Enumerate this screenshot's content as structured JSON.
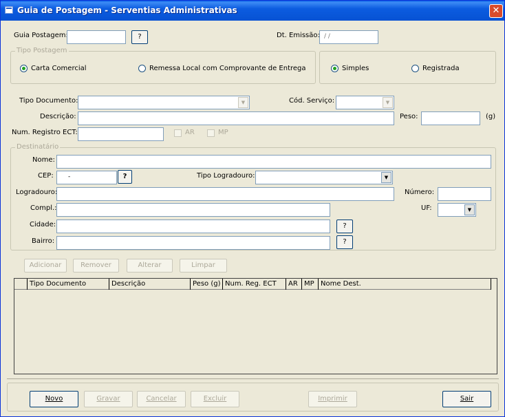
{
  "window": {
    "title": "Guia de Postagem - Serventias Administrativas",
    "close_glyph": "✕"
  },
  "header": {
    "guia_label": "Guia Postagem:",
    "guia_value": "",
    "guia_help": "?",
    "dt_label": "Dt. Emissão:",
    "dt_value": "/ /"
  },
  "tipo_postagem": {
    "caption": "Tipo Postagem",
    "options": [
      {
        "label": "Carta Comercial",
        "selected": true
      },
      {
        "label": "Remessa Local com Comprovante de Entrega",
        "selected": false
      }
    ]
  },
  "registro_tipo": {
    "options": [
      {
        "label": "Simples",
        "selected": true
      },
      {
        "label": "Registrada",
        "selected": false
      }
    ]
  },
  "documento": {
    "tipo_label": "Tipo Documento:",
    "tipo_value": "",
    "cod_label": "Cód. Serviço:",
    "cod_value": "",
    "descricao_label": "Descrição:",
    "descricao_value": "",
    "peso_label": "Peso:",
    "peso_value": "",
    "peso_unit": "(g)",
    "registro_label": "Num. Registro ECT:",
    "registro_value": "",
    "ar_label": "AR",
    "mp_label": "MP"
  },
  "destinatario": {
    "caption": "Destinatário",
    "nome_label": "Nome:",
    "cep_label": "CEP:",
    "cep_value": "-",
    "cep_help": "?",
    "tipo_logradouro_label": "Tipo Logradouro:",
    "logradouro_label": "Logradouro:",
    "numero_label": "Número:",
    "compl_label": "Compl.:",
    "uf_label": "UF:",
    "cidade_label": "Cidade:",
    "cidade_help": "?",
    "bairro_label": "Bairro:",
    "bairro_help": "?"
  },
  "list_actions": {
    "adicionar": "Adicionar",
    "remover": "Remover",
    "alterar": "Alterar",
    "limpar": "Limpar"
  },
  "table": {
    "columns": [
      "Tipo Documento",
      "Descrição",
      "Peso (g)",
      "Num. Reg. ECT",
      "AR",
      "MP",
      "Nome Dest."
    ],
    "rows": []
  },
  "footer": {
    "novo": "Novo",
    "gravar": "Gravar",
    "cancelar": "Cancelar",
    "excluir": "Excluir",
    "imprimir": "Imprimir",
    "sair": "Sair"
  },
  "colors": {
    "titlebar": "#0752d3",
    "window_bg": "#ece9d8",
    "close_button": "#d94b2b"
  }
}
